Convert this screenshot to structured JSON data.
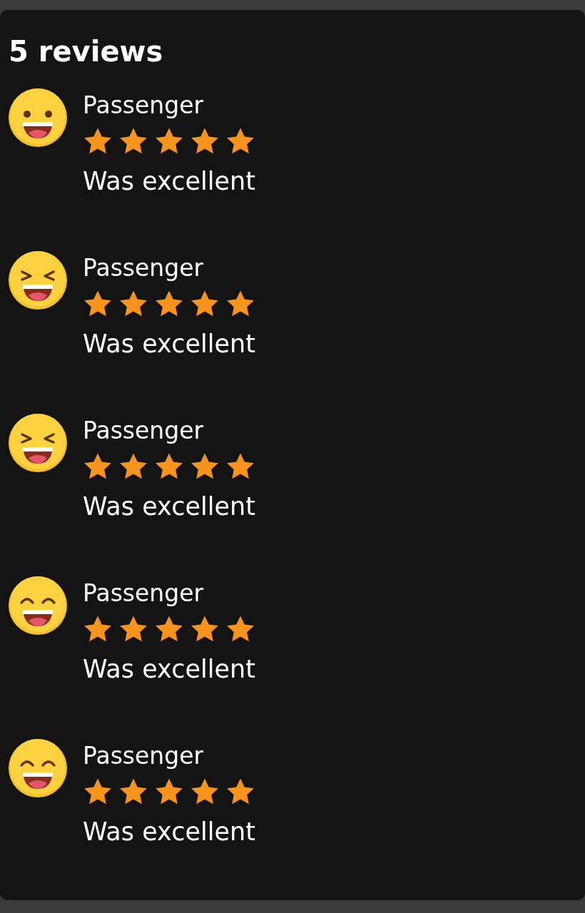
{
  "title": "5 reviews",
  "reviews": [
    {
      "kind": "grin",
      "name": "Passenger",
      "stars": 5,
      "comment": "Was excellent"
    },
    {
      "kind": "squint",
      "name": "Passenger",
      "stars": 5,
      "comment": "Was excellent"
    },
    {
      "kind": "squint",
      "name": "Passenger",
      "stars": 5,
      "comment": "Was excellent"
    },
    {
      "kind": "smile",
      "name": "Passenger",
      "stars": 5,
      "comment": "Was excellent"
    },
    {
      "kind": "smile",
      "name": "Passenger",
      "stars": 5,
      "comment": "Was excellent"
    }
  ]
}
